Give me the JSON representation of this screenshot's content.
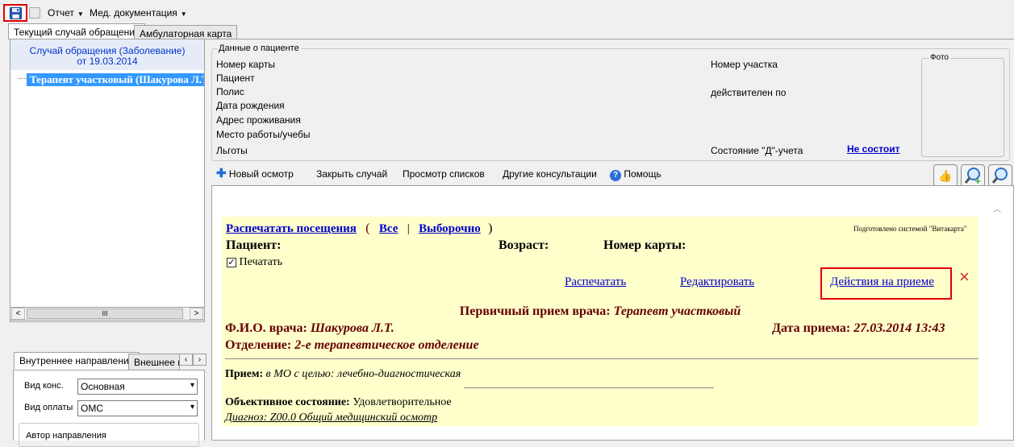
{
  "toolbar": {
    "menu_report": "Отчет",
    "menu_meddoc": "Мед. документация"
  },
  "tabs": [
    {
      "label": "Текущий случай обращения",
      "active": true
    },
    {
      "label": "Амбулаторная карта",
      "active": false
    }
  ],
  "case": {
    "title_line1": "Случай обращения (Заболевание)",
    "title_line2": "от 19.03.2014",
    "tree_item": "Терапевт участковый (Шакурова Л.Т."
  },
  "referral": {
    "tab_internal": "Внутреннее направление",
    "tab_external": "Внешнее на",
    "kind_label": "Вид конс.",
    "kind_value": "Основная",
    "payment_label": "Вид оплаты",
    "payment_value": "ОМС",
    "author_label": "Автор направления"
  },
  "patient_data": {
    "legend": "Данные о пациенте",
    "card_no": "Номер карты",
    "patient": "Пациент",
    "policy": "Полис",
    "birth_date": "Дата рождения",
    "address": "Адрес проживания",
    "work": "Место работы/учебы",
    "benefits": "Льготы",
    "district": "Номер участка",
    "valid_until": "действителен по",
    "d_status_label": "Состояние \"Д\"-учета",
    "d_status_value": "Не состоит",
    "photo_legend": "Фото"
  },
  "actions": {
    "new_exam": "Новый осмотр",
    "close_case": "Закрыть случай",
    "view_lists": "Просмотр списков",
    "other_consult": "Другие консультации",
    "help": "Помощь"
  },
  "document": {
    "print_visits": "Распечатать посещения",
    "open_paren": "(",
    "all": "Все",
    "separator": "|",
    "selective": "Выборочно",
    "close_paren": ")",
    "prepared_by": "Подготовлено системой \"Витакарта\"",
    "patient_label": "Пациент:",
    "age_label": "Возраст:",
    "card_label": "Номер карты:",
    "print_checkbox": "Печатать",
    "print_link": "Распечатать",
    "edit_link": "Редактировать",
    "actions_link": "Действия на приеме",
    "delete_icon": "×",
    "exam_title": "Первичный прием врача:",
    "exam_specialty": "Терапевт участковый",
    "doctor_label": "Ф.И.О. врача:",
    "doctor_name": "Шакурова Л.Т.",
    "date_label": "Дата приема:",
    "date_value": "27.03.2014 13:43",
    "dept_label": "Отделение:",
    "dept_value": "2-е терапевтическое отделение",
    "reception_label": "Прием:",
    "reception_place": "в МО с целью:",
    "reception_goal": "лечебно-диагностическая",
    "objective_label": "Объективное состояние:",
    "objective_value": "Удовлетворительное",
    "diagnosis": "Диагноз: Z00.0 Общий медицинский осмотр"
  },
  "colors": {
    "accent_blue": "#3399ff",
    "doc_background": "#ffffcc",
    "highlight_red": "#e00000",
    "dark_red_text": "#660000"
  }
}
